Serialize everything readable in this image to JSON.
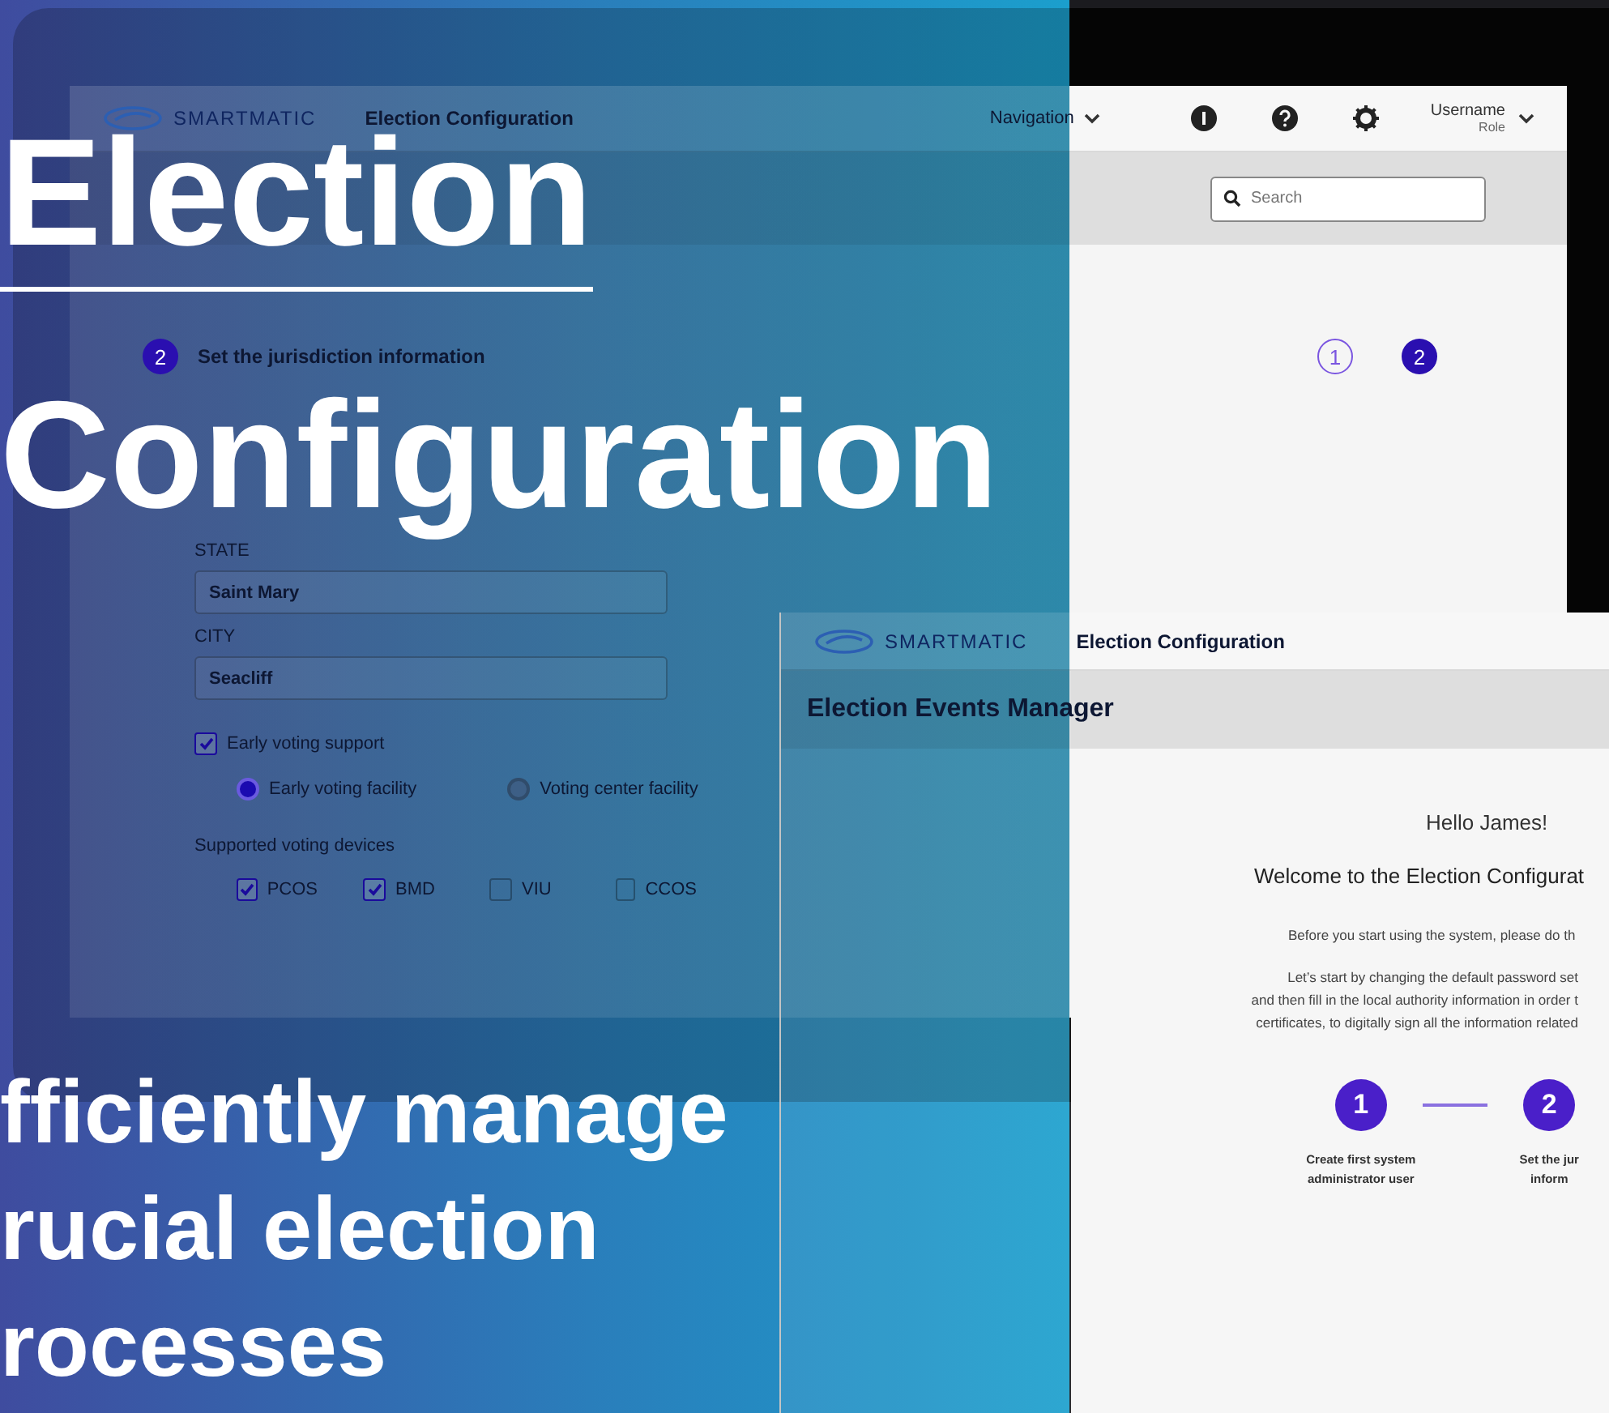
{
  "headline": {
    "title_lines": [
      "Election",
      "Configuration"
    ],
    "tagline_lines": [
      "fficiently manage",
      "rucial election",
      "rocesses"
    ]
  },
  "laptop_window": {
    "logo": "SMARTMATIC",
    "app_title": "Election Configuration",
    "nav_label": "Navigation",
    "user": {
      "name": "Username",
      "role": "Role"
    },
    "search": {
      "placeholder": "Search"
    },
    "steps": [
      {
        "label": "1",
        "selected": false
      },
      {
        "label": "2",
        "selected": true
      }
    ],
    "form": {
      "step_number": "2",
      "step_title": "Set the jurisdiction information",
      "fields": [
        {
          "label": "STATE",
          "value": "Saint Mary"
        },
        {
          "label": "CITY",
          "value": "Seacliff"
        }
      ],
      "early_voting": {
        "label": "Early voting support",
        "checked": true
      },
      "facilities": [
        {
          "label": "Early voting facility",
          "selected": true
        },
        {
          "label": "Voting center facility",
          "selected": false
        }
      ],
      "devices_label": "Supported voting devices",
      "devices": [
        {
          "label": "PCOS",
          "checked": true
        },
        {
          "label": "BMD",
          "checked": true
        },
        {
          "label": "VIU",
          "checked": false
        },
        {
          "label": "CCOS",
          "checked": false
        }
      ]
    }
  },
  "welcome_window": {
    "logo": "SMARTMATIC",
    "app_title": "Election Configuration",
    "page_title": "Election Events Manager",
    "greeting": "Hello James!",
    "welcome": "Welcome to the Election Configurat",
    "intro": "Before you start using the system, please do th",
    "intro_lines": [
      "Let’s start by changing the default password set",
      "and then fill in the local authority information in order t",
      "certificates, to digitally sign all the information related"
    ],
    "steps": [
      {
        "number": "1",
        "label_lines": [
          "Create first system",
          "administrator user"
        ]
      },
      {
        "number": "2",
        "label_lines": [
          "Set the jur",
          "inform"
        ]
      }
    ]
  }
}
